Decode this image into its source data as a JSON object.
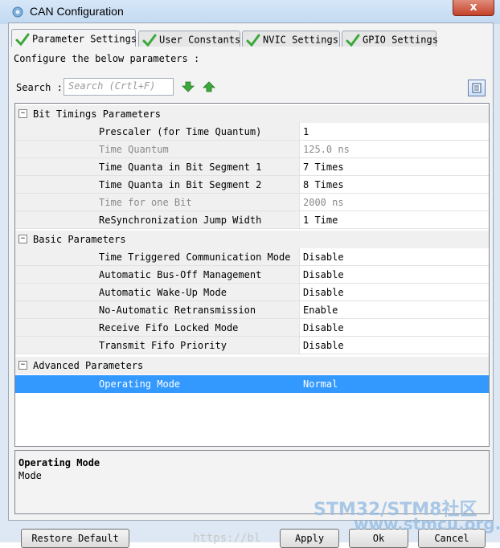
{
  "window": {
    "title": "CAN Configuration",
    "close_label": "x"
  },
  "tabs": [
    {
      "label": "Parameter Settings",
      "active": true
    },
    {
      "label": "User Constants",
      "active": false
    },
    {
      "label": "NVIC Settings",
      "active": false
    },
    {
      "label": "GPIO Settings",
      "active": false
    }
  ],
  "configure_label": "Configure the below parameters :",
  "search": {
    "label": "Search :",
    "placeholder": "Search (Crtl+F)"
  },
  "groups": [
    {
      "title": "Bit Timings Parameters",
      "expander": "−",
      "rows": [
        {
          "name": "Prescaler (for Time Quantum)",
          "value": "1",
          "disabled": false
        },
        {
          "name": "Time Quantum",
          "value": "125.0 ns",
          "disabled": true
        },
        {
          "name": "Time Quanta in Bit Segment 1",
          "value": "7 Times",
          "disabled": false
        },
        {
          "name": "Time Quanta in Bit Segment 2",
          "value": "8 Times",
          "disabled": false
        },
        {
          "name": "Time for one Bit",
          "value": "2000 ns",
          "disabled": true
        },
        {
          "name": "ReSynchronization Jump Width",
          "value": "1 Time",
          "disabled": false
        }
      ]
    },
    {
      "title": "Basic Parameters",
      "expander": "−",
      "rows": [
        {
          "name": "Time Triggered Communication Mode",
          "value": "Disable",
          "disabled": false
        },
        {
          "name": "Automatic Bus-Off Management",
          "value": "Disable",
          "disabled": false
        },
        {
          "name": "Automatic Wake-Up Mode",
          "value": "Disable",
          "disabled": false
        },
        {
          "name": "No-Automatic Retransmission",
          "value": "Enable",
          "disabled": false
        },
        {
          "name": "Receive Fifo Locked Mode",
          "value": "Disable",
          "disabled": false
        },
        {
          "name": "Transmit Fifo Priority",
          "value": "Disable",
          "disabled": false
        }
      ]
    },
    {
      "title": "Advanced Parameters",
      "expander": "−",
      "rows": [
        {
          "name": "Operating Mode",
          "value": "Normal",
          "disabled": false,
          "selected": true
        }
      ]
    }
  ],
  "description": {
    "title": "Operating Mode",
    "text": "Mode"
  },
  "buttons": {
    "restore": "Restore Default",
    "apply": "Apply",
    "ok": "Ok",
    "cancel": "Cancel"
  },
  "watermark": {
    "brand": "STM32/STM8社区",
    "site": "www.stmcu.org.cn",
    "url_fragment": "https://bl"
  },
  "colors": {
    "selection": "#3399ff",
    "check": "#3aa83a",
    "arrow": "#3aa83a"
  },
  "icons": {
    "app": "gear-icon",
    "check": "check-icon",
    "down": "arrow-down-icon",
    "up": "arrow-up-icon",
    "list": "list-view-icon"
  }
}
